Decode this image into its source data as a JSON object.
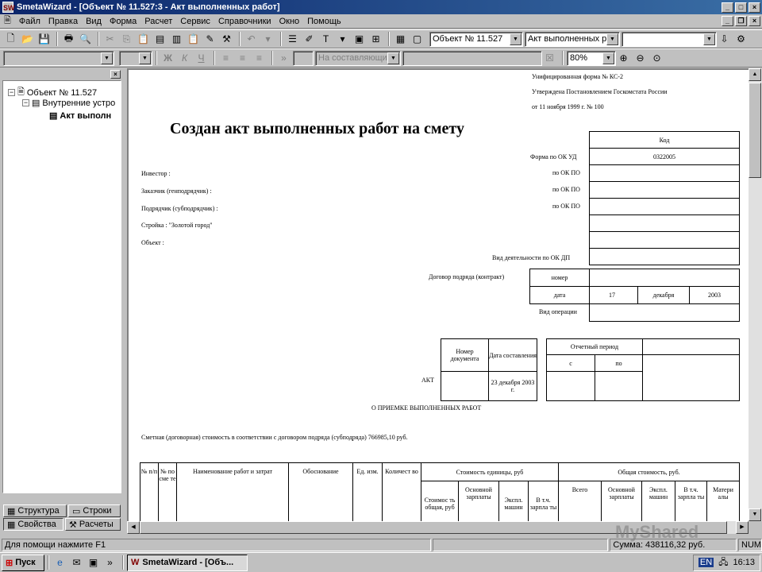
{
  "window": {
    "title": "SmetaWizard - [Объект № 11.527:3 - Акт выполненных работ]",
    "app_icon": "SW"
  },
  "menu": {
    "items": [
      "Файл",
      "Правка",
      "Вид",
      "Форма",
      "Расчет",
      "Сервис",
      "Справочники",
      "Окно",
      "Помощь"
    ]
  },
  "toolbar": {
    "object_combo": "Объект № 11.527",
    "form_combo": "Акт выполненных раб",
    "empty_combo": ""
  },
  "toolbar2": {
    "style_combo": "На составляющие",
    "zoom_combo": "80%",
    "bold": "Ж",
    "italic": "К",
    "underline": "Ч"
  },
  "tree": {
    "items": [
      {
        "label": "Объект № 11.527",
        "expander": "−"
      },
      {
        "label": "Внутренние устро",
        "expander": "−"
      },
      {
        "label": "Акт выполн"
      }
    ]
  },
  "panel_tabs": {
    "structure": "Структура",
    "rows": "Строки",
    "properties": "Свойства",
    "calcs": "Расчеты"
  },
  "document": {
    "header_lines": [
      "Унифицированная форма № КС-2",
      "Утверждена Постановлением Госкомстата России",
      "от 11 ноября 1999 г. № 100"
    ],
    "big_title": "Создан акт выполненных работ на смету",
    "code_header": "Код",
    "form_label": "Форма по  ОК УД",
    "form_code": "0322005",
    "okpo_label": "по  ОК ПО",
    "okdp_label": "Вид деятельности по  ОК ДП",
    "investor": "Инвестор :",
    "customer": "Заказчик (генподрядчик) :",
    "contractor": "Подрядчик (субподрядчик) :",
    "construction": "Стройка : \"Золотой город\"",
    "object": "Объект :",
    "contract_label": "Договор подряда (контракт)",
    "number_label": "номер",
    "date_label": "дата",
    "contract_day": "17",
    "contract_month": "декабря",
    "contract_year": "2003",
    "operation_label": "Вид операции",
    "doc_number_header": "Номер документа",
    "doc_date_header": "Дата составления",
    "period_header": "Отчетный период",
    "from_label": "с",
    "to_label": "по",
    "act_label": "АКТ",
    "act_date": "23 декабря 2003 г.",
    "act_subtitle": "О ПРИЕМКЕ ВЫПОЛНЕННЫХ РАБОТ",
    "cost_line": "Сметная (договорная) стоимость в соответствии с договором подряда (субподряда)  766985,10  руб.",
    "table_headers": {
      "n": "№ п/п",
      "n_smeta": "№ по сме те",
      "name": "Наименование работ и затрат",
      "basis": "Обоснование",
      "unit": "Ед. изм.",
      "qty": "Количест во",
      "unit_cost": "Стоимость единицы, руб",
      "total_cost": "Общая стоимость, руб.",
      "sub_total": "Стоимос ть общая, руб",
      "sub_wage": "Основной зарплаты",
      "sub_mach": "Экспл. машин",
      "sub_incl": "В т.ч. зарпла ты",
      "sub_all": "Всего",
      "sub_wage2": "Основной зарплаты",
      "sub_mach2": "Экспл. машин",
      "sub_incl2": "В т.ч. зарпла ты",
      "sub_mat": "Матери алы"
    }
  },
  "status": {
    "help": "Для помощи нажмите F1",
    "sum": "Сумма: 438116,32 руб.",
    "num": "NUM"
  },
  "taskbar": {
    "start": "Пуск",
    "task": "SmetaWizard - [Объ...",
    "time": "16:13",
    "chevron": "»"
  },
  "watermark": "MyShared"
}
